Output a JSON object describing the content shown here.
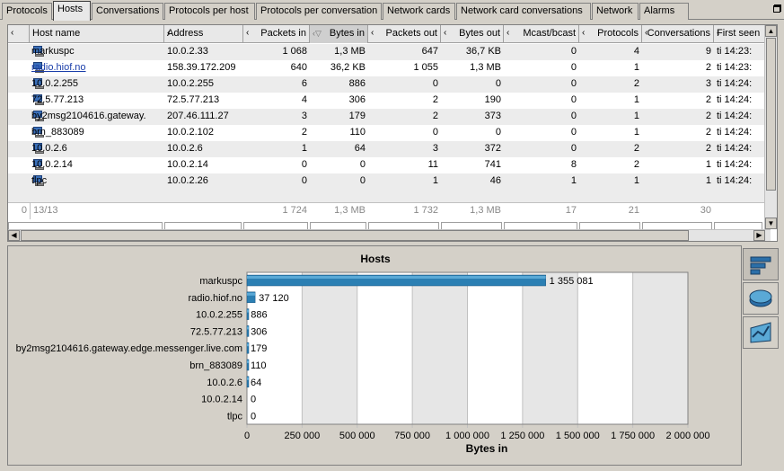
{
  "tabs": [
    {
      "label": "Protocols",
      "active": false
    },
    {
      "label": "Hosts",
      "active": true
    },
    {
      "label": "Conversations",
      "active": false
    },
    {
      "label": "Protocols per host",
      "active": false
    },
    {
      "label": "Protocols per conversation",
      "active": false
    },
    {
      "label": "Network cards",
      "active": false
    },
    {
      "label": "Network card conversations",
      "active": false
    },
    {
      "label": "Network",
      "active": false
    },
    {
      "label": "Alarms",
      "active": false
    }
  ],
  "table": {
    "columns": [
      {
        "label": "Host name"
      },
      {
        "label": "Address"
      },
      {
        "label": "Packets in"
      },
      {
        "label": "Bytes in",
        "sorted": "descending"
      },
      {
        "label": "Packets out"
      },
      {
        "label": "Bytes out"
      },
      {
        "label": "Mcast/bcast"
      },
      {
        "label": "Protocols"
      },
      {
        "label": "Conversations"
      },
      {
        "label": "First seen"
      }
    ],
    "rows": [
      {
        "host": "markuspc",
        "address": "10.0.2.33",
        "packets_in": "1 068",
        "bytes_in": "1,3 MB",
        "packets_out": "647",
        "bytes_out": "36,7 KB",
        "mcast": "0",
        "protocols": "4",
        "conversations": "9",
        "first_seen": "ti 14:23:"
      },
      {
        "host": "radio.hiof.no",
        "address": "158.39.172.209",
        "packets_in": "640",
        "bytes_in": "36,2 KB",
        "packets_out": "1 055",
        "bytes_out": "1,3 MB",
        "mcast": "0",
        "protocols": "1",
        "conversations": "2",
        "first_seen": "ti 14:23:",
        "link": true
      },
      {
        "host": "10.0.2.255",
        "address": "10.0.2.255",
        "packets_in": "6",
        "bytes_in": "886",
        "packets_out": "0",
        "bytes_out": "0",
        "mcast": "0",
        "protocols": "2",
        "conversations": "3",
        "first_seen": "ti 14:24:"
      },
      {
        "host": "72.5.77.213",
        "address": "72.5.77.213",
        "packets_in": "4",
        "bytes_in": "306",
        "packets_out": "2",
        "bytes_out": "190",
        "mcast": "0",
        "protocols": "1",
        "conversations": "2",
        "first_seen": "ti 14:24:"
      },
      {
        "host": "by2msg2104616.gateway.",
        "address": "207.46.111.27",
        "packets_in": "3",
        "bytes_in": "179",
        "packets_out": "2",
        "bytes_out": "373",
        "mcast": "0",
        "protocols": "1",
        "conversations": "2",
        "first_seen": "ti 14:24:"
      },
      {
        "host": "brn_883089",
        "address": "10.0.2.102",
        "packets_in": "2",
        "bytes_in": "110",
        "packets_out": "0",
        "bytes_out": "0",
        "mcast": "0",
        "protocols": "1",
        "conversations": "2",
        "first_seen": "ti 14:24:"
      },
      {
        "host": "10.0.2.6",
        "address": "10.0.2.6",
        "packets_in": "1",
        "bytes_in": "64",
        "packets_out": "3",
        "bytes_out": "372",
        "mcast": "0",
        "protocols": "2",
        "conversations": "2",
        "first_seen": "ti 14:24:"
      },
      {
        "host": "10.0.2.14",
        "address": "10.0.2.14",
        "packets_in": "0",
        "bytes_in": "0",
        "packets_out": "11",
        "bytes_out": "741",
        "mcast": "8",
        "protocols": "2",
        "conversations": "1",
        "first_seen": "ti 14:24:"
      },
      {
        "host": "tlpc",
        "address": "10.0.2.26",
        "packets_in": "0",
        "bytes_in": "0",
        "packets_out": "1",
        "bytes_out": "46",
        "mcast": "1",
        "protocols": "1",
        "conversations": "1",
        "first_seen": "ti 14:24:"
      }
    ],
    "summary": {
      "index": "0",
      "count": "13/13",
      "packets_in": "1 724",
      "bytes_in": "1,3 MB",
      "packets_out": "1 732",
      "bytes_out": "1,3 MB",
      "mcast": "17",
      "protocols": "21",
      "conversations": "30"
    }
  },
  "side_buttons": [
    {
      "icon": "bar-chart-icon",
      "active": true
    },
    {
      "icon": "pie-chart-icon",
      "active": false
    },
    {
      "icon": "line-chart-icon",
      "active": false
    }
  ],
  "colors": {
    "bar": "#2b7fb3",
    "bar_highlight": "#5aa9d6",
    "link": "#1a3eaa"
  },
  "chart_data": {
    "type": "bar",
    "orientation": "horizontal",
    "title": "Hosts",
    "xlabel": "Bytes in",
    "ylabel": "",
    "categories": [
      "markuspc",
      "radio.hiof.no",
      "10.0.2.255",
      "72.5.77.213",
      "by2msg2104616.gateway.edge.messenger.live.com",
      "brn_883089",
      "10.0.2.6",
      "10.0.2.14",
      "tlpc"
    ],
    "values": [
      1355081,
      37120,
      886,
      306,
      179,
      110,
      64,
      0,
      0
    ],
    "value_labels": [
      "1 355 081",
      "37 120",
      "886",
      "306",
      "179",
      "110",
      "64",
      "0",
      "0"
    ],
    "xlim": [
      0,
      2000000
    ],
    "xticks": [
      0,
      250000,
      500000,
      750000,
      1000000,
      1250000,
      1500000,
      1750000,
      2000000
    ],
    "xtick_labels": [
      "0",
      "250 000",
      "500 000",
      "750 000",
      "1 000 000",
      "1 250 000",
      "1 500 000",
      "1 750 000",
      "2 000 000"
    ],
    "grid": "alternating vertical bands"
  }
}
